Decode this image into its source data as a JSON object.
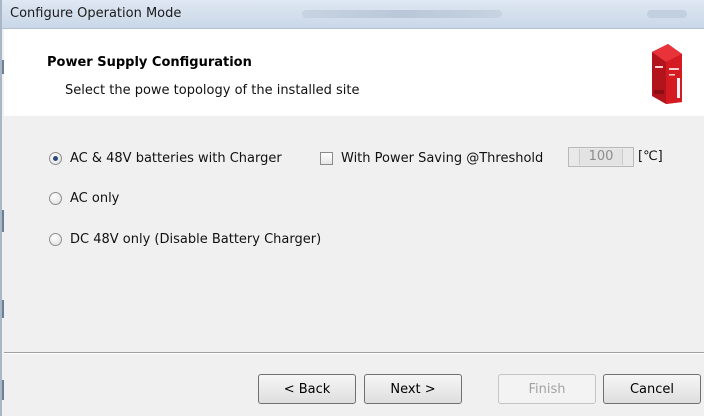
{
  "window": {
    "title": "Configure Operation Mode"
  },
  "header": {
    "title": "Power Supply Configuration",
    "subtitle": "Select the powe topology of the installed site"
  },
  "options": [
    {
      "label": "AC & 48V batteries with Charger",
      "selected": true
    },
    {
      "label": "AC only",
      "selected": false
    },
    {
      "label": "DC 48V only (Disable Battery Charger)",
      "selected": false
    }
  ],
  "power_saving": {
    "label": "With Power Saving @Threshold",
    "checked": false,
    "value": "100",
    "unit": "[℃]"
  },
  "buttons": {
    "back": "< Back",
    "next": "Next >",
    "finish": "Finish",
    "cancel": "Cancel"
  },
  "colors": {
    "device": "#d61a22",
    "header_bg": "#ffffff",
    "dialog_bg": "#f0f0f0"
  }
}
